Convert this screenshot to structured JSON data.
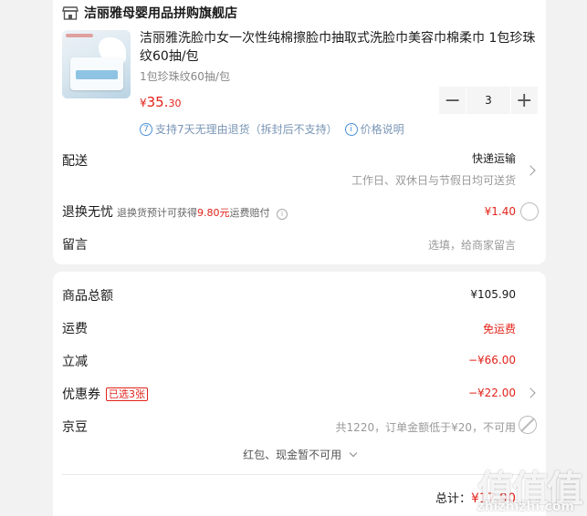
{
  "shop": {
    "name": "洁丽雅母婴用品拼购旗舰店"
  },
  "product": {
    "title": "洁丽雅洗脸巾女一次性纯棉擦脸巾抽取式洗脸巾美容巾棉柔巾 1包珍珠纹60抽/包",
    "spec": "1包珍珠纹60抽/包",
    "price_symbol": "¥",
    "price_int": "35.",
    "price_dec": "30",
    "quantity": "3",
    "minus_label": "−",
    "plus_label": "+",
    "service_icon": "7",
    "service_text": "支持7天无理由退货（拆封后不支持）",
    "price_info_icon": "i",
    "price_info_text": "价格说明"
  },
  "delivery": {
    "label": "配送",
    "method": "快递运输",
    "schedule": "工作日、双休日与节假日均可送货"
  },
  "return_worry": {
    "label": "退换无忧",
    "desc_prefix": "退换货预计可获得",
    "desc_amount": "9.80元",
    "desc_suffix": "运费赔付",
    "info_icon": "i",
    "price": "¥1.40"
  },
  "message": {
    "label": "留言",
    "placeholder": "选填，给商家留言"
  },
  "summary": {
    "goods_total_label": "商品总额",
    "goods_total": "¥105.90",
    "shipping_label": "运费",
    "shipping": "免运费",
    "discount_label": "立减",
    "discount": "−¥66.00",
    "coupon_label": "优惠券",
    "coupon_tag": "已选3张",
    "coupon": "−¥22.00",
    "jd_bean_label": "京豆",
    "jd_bean_text": "共1220，订单金额低于¥20，不可用",
    "redpacket_text": "红包、现金暂不可用",
    "total_label": "总计：",
    "total": "¥17.90"
  },
  "watermark": {
    "main": "值值值",
    "sub": "zhizhizhi.com"
  },
  "colors": {
    "accent": "#e2231a",
    "link": "#4a90d9"
  }
}
